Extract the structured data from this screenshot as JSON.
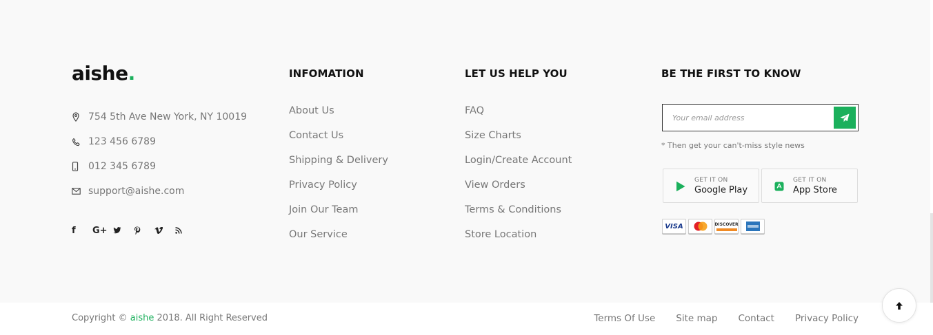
{
  "brand": {
    "name": "aishe",
    "dot": ".",
    "accent_color": "#1bb05c"
  },
  "contact": [
    {
      "icon": "map-pin-icon",
      "text": "754 5th Ave New York, NY 10019"
    },
    {
      "icon": "phone-icon",
      "text": "123 456 6789"
    },
    {
      "icon": "mobile-icon",
      "text": "012 345 6789"
    },
    {
      "icon": "mail-icon",
      "text": "support@aishe.com"
    }
  ],
  "social": [
    {
      "icon": "facebook-icon",
      "glyph": "f"
    },
    {
      "icon": "google-plus-icon",
      "glyph": "G+"
    },
    {
      "icon": "twitter-icon",
      "glyph": "t"
    },
    {
      "icon": "pinterest-icon",
      "glyph": "P"
    },
    {
      "icon": "vimeo-icon",
      "glyph": "V"
    },
    {
      "icon": "rss-icon",
      "glyph": "rss"
    }
  ],
  "information": {
    "title": "INFOMATION",
    "links": [
      "About Us",
      "Contact Us",
      "Shipping & Delivery",
      "Privacy Policy",
      "Join Our Team",
      "Our Service"
    ]
  },
  "help": {
    "title": "LET US HELP YOU",
    "links": [
      "FAQ",
      "Size Charts",
      "Login/Create Account",
      "View Orders",
      "Terms & Conditions",
      "Store Location"
    ]
  },
  "newsletter": {
    "title": "BE THE FIRST TO KNOW",
    "placeholder": "Your email address",
    "send_icon": "paper-plane-icon",
    "note": "* Then get your can't-miss style news"
  },
  "stores": [
    {
      "icon": "google-play-icon",
      "small": "GET IT ON",
      "big": "Google Play"
    },
    {
      "icon": "app-store-icon",
      "small": "GET IT ON",
      "big": "App Store"
    }
  ],
  "payment_cards": [
    "visa-card-icon",
    "mastercard-icon",
    "discover-card-icon",
    "amex-card-icon"
  ],
  "payment_text": {
    "visa": "VISA",
    "discover": "DISCOVER"
  },
  "copyright": {
    "prefix": "Copyright © ",
    "brand": "aishe",
    "suffix": " 2018. All Right Reserved"
  },
  "bottom_links": [
    "Terms Of Use",
    "Site map",
    "Contact",
    "Privacy Policy"
  ],
  "to_top_icon": "arrow-up-icon"
}
